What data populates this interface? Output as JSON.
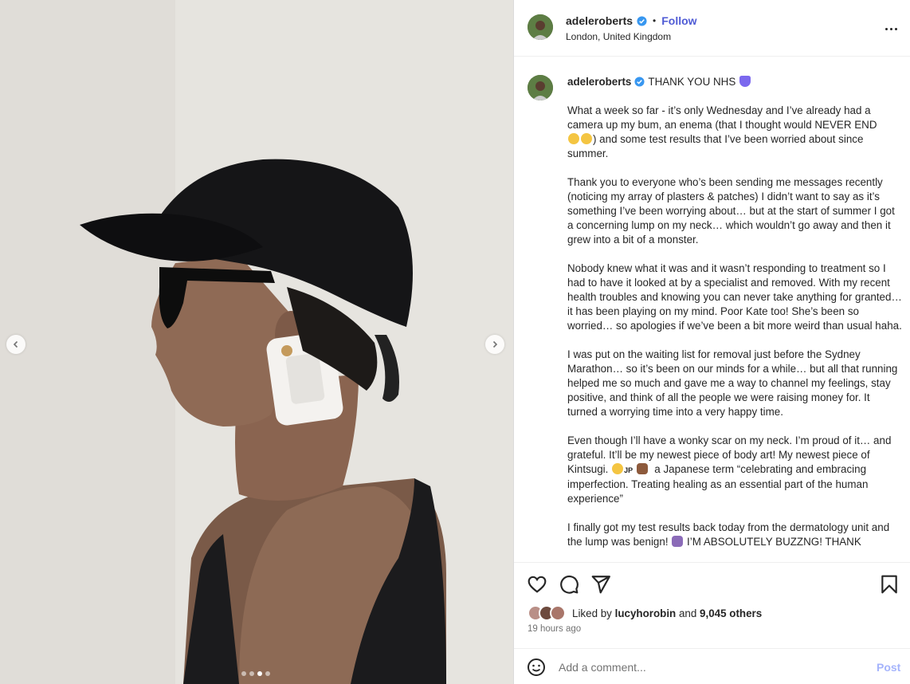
{
  "header": {
    "username": "adeleroberts",
    "separator": "•",
    "follow_label": "Follow",
    "location": "London, United Kingdom",
    "more_icon": "more-horizontal-icon"
  },
  "caption": {
    "username": "adeleroberts",
    "headline": "THANK YOU NHS",
    "paragraphs": [
      "What a week so far - it’s only Wednesday and I’ve already had a camera up my bum, an enema (that I thought would NEVER END",
      "Thank you to everyone who’s been sending me messages recently (noticing my array of plasters & patches) I didn’t want to say as it’s something I’ve been worrying about… but at the start of summer I got a concerning lump on my neck… which wouldn’t go away and then it grew into a bit of a monster.",
      "Nobody knew what it was and it wasn’t responding to treatment so I had to have it looked at by a specialist and removed. With my recent health troubles and knowing you can never take anything for granted… it has been playing on my mind. Poor Kate too! She’s been so worried… so apologies if we’ve been a bit more weird than usual haha.",
      "I was put on the waiting list for removal just before the Sydney Marathon… so it’s been on our minds for a while… but all that running helped me so much and gave me a way to channel my feelings, stay positive, and think of all the people we were raising money for. It turned a worrying time into a very happy time.",
      "Even though I’ll have a wonky scar on my neck. I’m proud of it… and grateful. It’ll be my newest piece of body art! My newest piece of Kintsugi.",
      "I finally got my test results back today from the dermatology unit and the lump was benign!"
    ],
    "p1_tail": ") and some test results that I’ve been worried about since summer.",
    "p5_tail": "a Japanese term “celebrating and embracing imperfection. Treating healing as an essential part of the human experience”",
    "p5_jp": "JP",
    "p6_tail": "I’M ABSOLUTELY BUZZNG! THANK"
  },
  "likes": {
    "prefix": "Liked by",
    "user": "lucyhorobin",
    "and": "and",
    "count": "9,045 others"
  },
  "time_ago": "19 hours ago",
  "comment": {
    "placeholder": "Add a comment...",
    "post_label": "Post"
  },
  "carousel": {
    "total": 4,
    "active_index": 2
  },
  "colors": {
    "follow": "#4f5bd5",
    "verified": "#3897f0",
    "post_disabled": "#a5b4fc",
    "heart_emoji": "#7b68ee"
  }
}
